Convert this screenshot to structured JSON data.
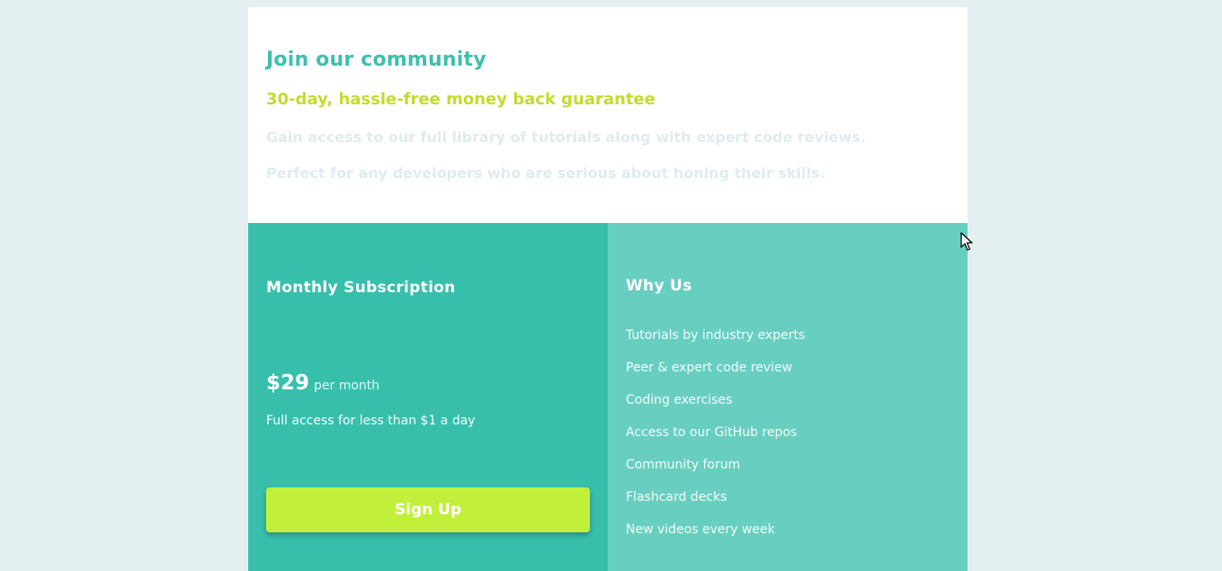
{
  "header": {
    "title": "Join our community",
    "subtitle": "30-day, hassle-free money back guarantee",
    "description_line1": "Gain access to our full library of tutorials along with expert code reviews.",
    "description_line2": "Perfect for any developers who are serious about honing their skills."
  },
  "subscription": {
    "title": "Monthly Subscription",
    "price": "$29",
    "period": "per month",
    "note": "Full access for less than $1 a day",
    "button_label": "Sign Up"
  },
  "why_us": {
    "title": "Why Us",
    "items": [
      "Tutorials by industry experts",
      "Peer & expert code review",
      "Coding exercises",
      "Access to our GitHub repos",
      "Community forum",
      "Flashcard decks",
      "New videos every week"
    ]
  },
  "colors": {
    "page_background": "#e3eff0",
    "title": "#3ebfad",
    "subtitle": "#c2dc2c",
    "left_panel": "#37bfac",
    "right_panel": "#68cfc0",
    "button": "#c2f03a"
  },
  "icons": {
    "cursor": "mouse-pointer-icon"
  }
}
